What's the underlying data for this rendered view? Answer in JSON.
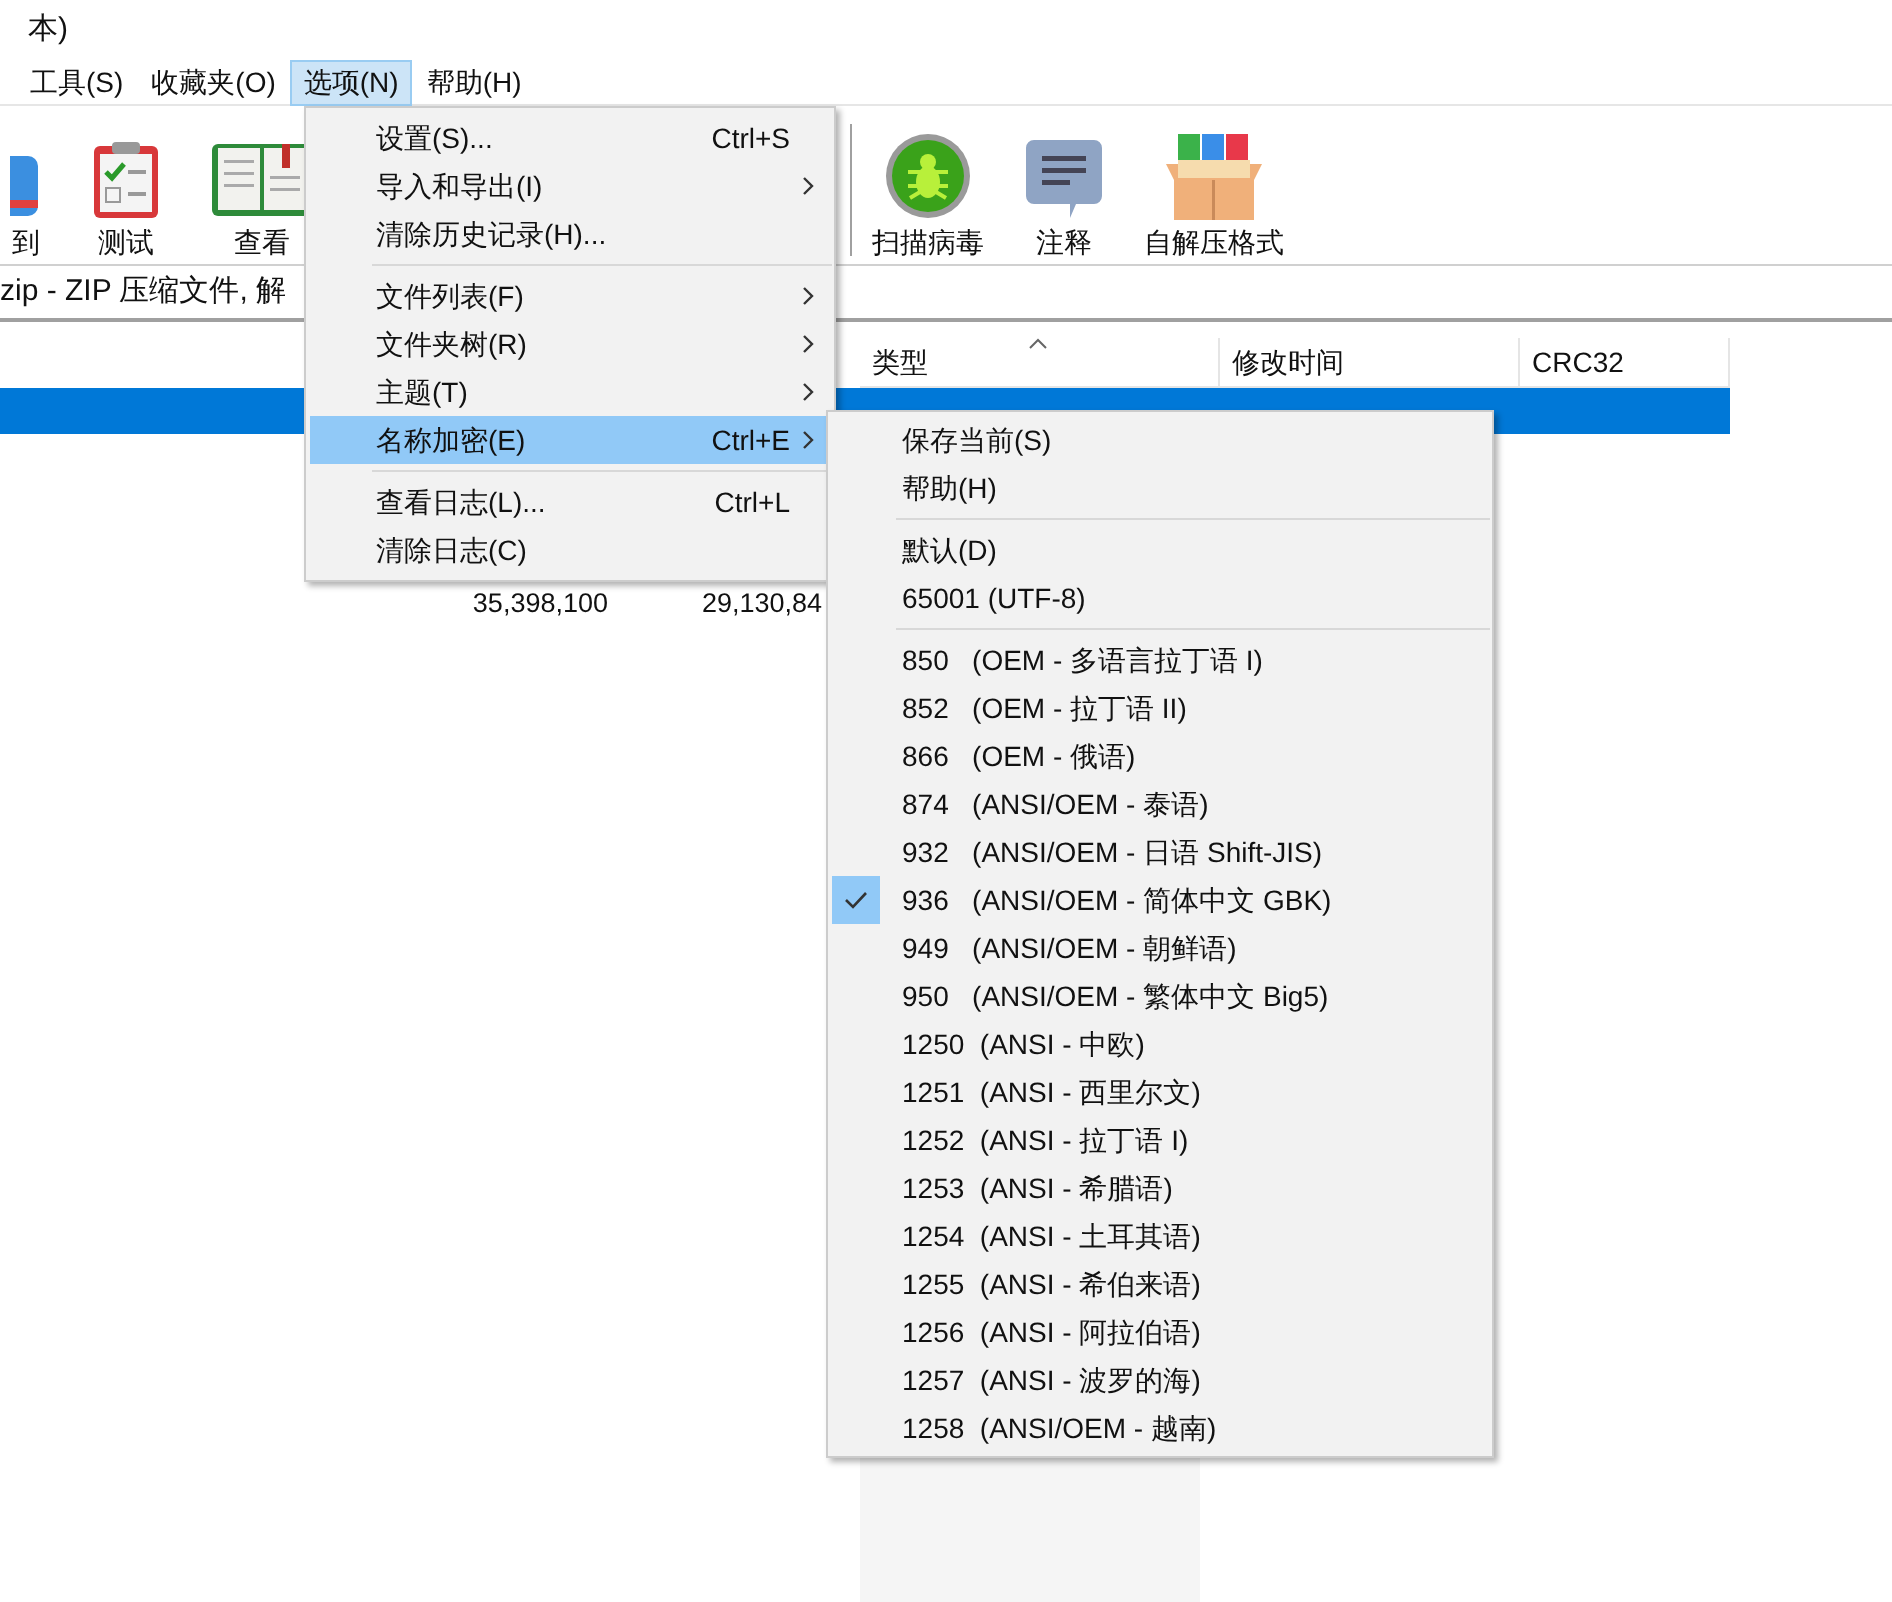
{
  "window": {
    "title": "本)"
  },
  "menu_bar": [
    {
      "label": "工具(S)",
      "selected": false
    },
    {
      "label": "收藏夹(O)",
      "selected": false
    },
    {
      "label": "选项(N)",
      "selected": true
    },
    {
      "label": "帮助(H)",
      "selected": false
    }
  ],
  "toolbar_left": [
    {
      "kind": "extract",
      "label": "到"
    },
    {
      "kind": "test",
      "label": "测试"
    },
    {
      "kind": "view",
      "label": "查看"
    }
  ],
  "toolbar_right": [
    {
      "kind": "scan",
      "label": "扫描病毒"
    },
    {
      "kind": "comment",
      "label": "注释"
    },
    {
      "kind": "sfx",
      "label": "自解压格式"
    }
  ],
  "address": "zip - ZIP 压缩文件, 解",
  "table": {
    "columns": [
      {
        "label": "类型",
        "sorted": true
      },
      {
        "label": "修改时间",
        "sorted": false
      },
      {
        "label": "CRC32",
        "sorted": false
      }
    ],
    "rows": [
      {
        "selected": true,
        "cells": []
      },
      {
        "selected": false,
        "cells": [
          "35,398,100",
          "29,130,84"
        ]
      }
    ]
  },
  "options_menu": {
    "items": [
      {
        "kind": "item",
        "label": "设置(S)...",
        "shortcut": "Ctrl+S",
        "submenu": false,
        "selected": false
      },
      {
        "kind": "item",
        "label": "导入和导出(I)",
        "submenu": true,
        "selected": false
      },
      {
        "kind": "item",
        "label": "清除历史记录(H)...",
        "submenu": false,
        "selected": false
      },
      {
        "kind": "separator"
      },
      {
        "kind": "item",
        "label": "文件列表(F)",
        "submenu": true,
        "selected": false
      },
      {
        "kind": "item",
        "label": "文件夹树(R)",
        "submenu": true,
        "selected": false
      },
      {
        "kind": "item",
        "label": "主题(T)",
        "submenu": true,
        "selected": false
      },
      {
        "kind": "item",
        "label": "名称加密(E)",
        "shortcut": "Ctrl+E",
        "submenu": true,
        "selected": true
      },
      {
        "kind": "separator"
      },
      {
        "kind": "item",
        "label": "查看日志(L)...",
        "shortcut": "Ctrl+L",
        "submenu": false,
        "selected": false
      },
      {
        "kind": "item",
        "label": "清除日志(C)",
        "submenu": false,
        "selected": false
      }
    ]
  },
  "encoding_menu": {
    "items": [
      {
        "kind": "item",
        "label": "保存当前(S)",
        "checked": false
      },
      {
        "kind": "item",
        "label": "帮助(H)",
        "checked": false
      },
      {
        "kind": "separator"
      },
      {
        "kind": "item",
        "label": "默认(D)",
        "checked": false
      },
      {
        "kind": "item",
        "label": "65001 (UTF-8)",
        "checked": false
      },
      {
        "kind": "separator"
      },
      {
        "kind": "item",
        "label": "850   (OEM - 多语言拉丁语 I)",
        "checked": false
      },
      {
        "kind": "item",
        "label": "852   (OEM - 拉丁语 II)",
        "checked": false
      },
      {
        "kind": "item",
        "label": "866   (OEM - 俄语)",
        "checked": false
      },
      {
        "kind": "item",
        "label": "874   (ANSI/OEM - 泰语)",
        "checked": false
      },
      {
        "kind": "item",
        "label": "932   (ANSI/OEM - 日语 Shift-JIS)",
        "checked": false
      },
      {
        "kind": "item",
        "label": "936   (ANSI/OEM - 简体中文 GBK)",
        "checked": true
      },
      {
        "kind": "item",
        "label": "949   (ANSI/OEM - 朝鲜语)",
        "checked": false
      },
      {
        "kind": "item",
        "label": "950   (ANSI/OEM - 繁体中文 Big5)",
        "checked": false
      },
      {
        "kind": "item",
        "label": "1250  (ANSI - 中欧)",
        "checked": false
      },
      {
        "kind": "item",
        "label": "1251  (ANSI - 西里尔文)",
        "checked": false
      },
      {
        "kind": "item",
        "label": "1252  (ANSI - 拉丁语 I)",
        "checked": false
      },
      {
        "kind": "item",
        "label": "1253  (ANSI - 希腊语)",
        "checked": false
      },
      {
        "kind": "item",
        "label": "1254  (ANSI - 土耳其语)",
        "checked": false
      },
      {
        "kind": "item",
        "label": "1255  (ANSI - 希伯来语)",
        "checked": false
      },
      {
        "kind": "item",
        "label": "1256  (ANSI - 阿拉伯语)",
        "checked": false
      },
      {
        "kind": "item",
        "label": "1257  (ANSI - 波罗的海)",
        "checked": false
      },
      {
        "kind": "item",
        "label": "1258  (ANSI/OEM - 越南)",
        "checked": false
      }
    ]
  }
}
